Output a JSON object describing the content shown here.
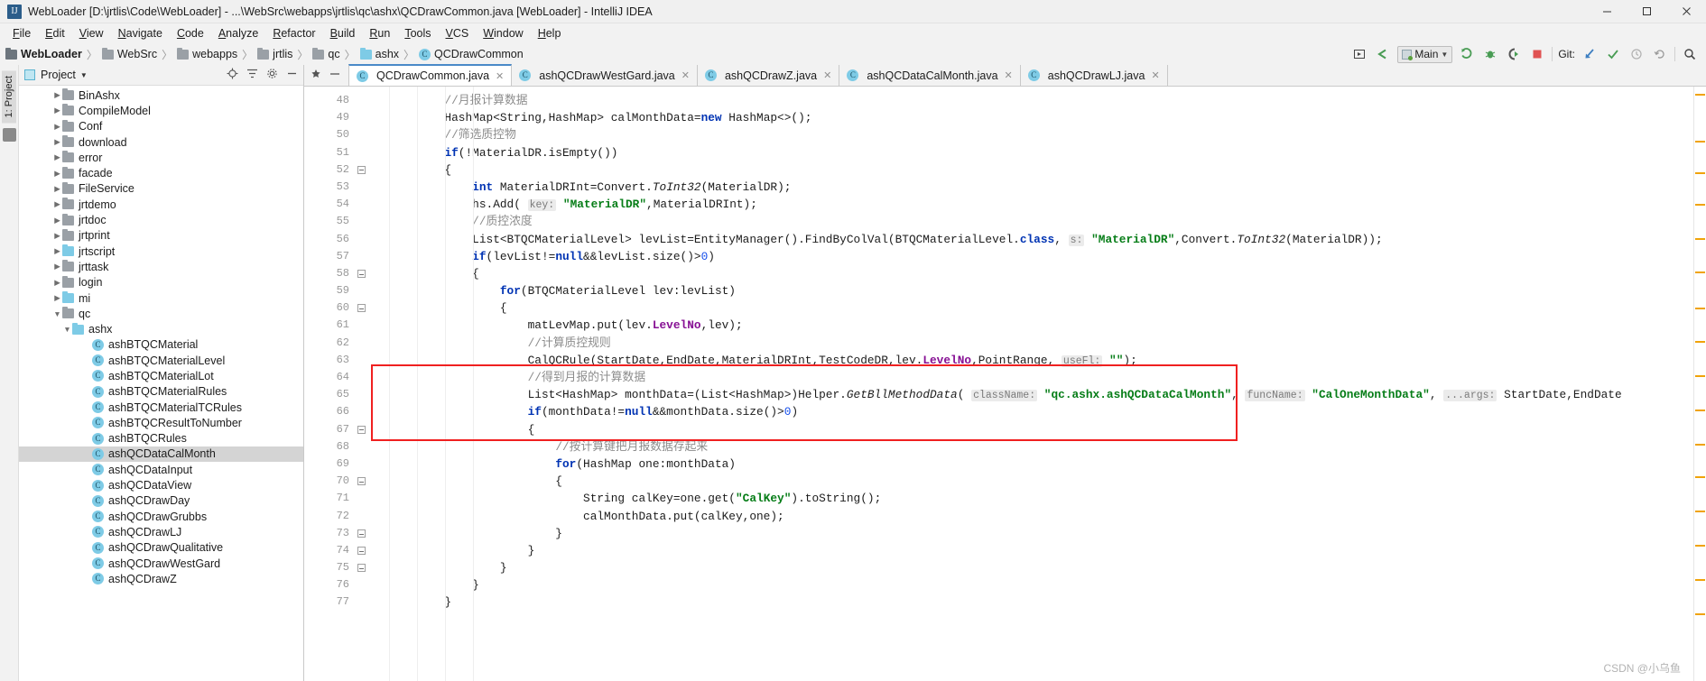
{
  "window": {
    "title": "WebLoader [D:\\jrtlis\\Code\\WebLoader] - ...\\WebSrc\\webapps\\jrtlis\\qc\\ashx\\QCDrawCommon.java [WebLoader] - IntelliJ IDEA",
    "app_icon": "IJ",
    "controls": {
      "minimize": "minimize-icon",
      "maximize": "maximize-icon",
      "close": "close-icon"
    }
  },
  "menubar": [
    "File",
    "Edit",
    "View",
    "Navigate",
    "Code",
    "Analyze",
    "Refactor",
    "Build",
    "Run",
    "Tools",
    "VCS",
    "Window",
    "Help"
  ],
  "breadcrumb": [
    {
      "label": "WebLoader",
      "type": "project",
      "bold": true
    },
    {
      "label": "WebSrc",
      "type": "folder"
    },
    {
      "label": "webapps",
      "type": "folder"
    },
    {
      "label": "jrtlis",
      "type": "folder"
    },
    {
      "label": "qc",
      "type": "folder"
    },
    {
      "label": "ashx",
      "type": "folder-blue"
    },
    {
      "label": "QCDrawCommon",
      "type": "class"
    }
  ],
  "toolbar": {
    "run_config": "Main",
    "git_label": "Git:",
    "icons": [
      "layout-icon",
      "back-arrow-icon",
      "run-icon",
      "debug-icon",
      "run-coverage-icon",
      "stop-icon",
      "git-update-icon",
      "git-commit-icon",
      "git-history-icon",
      "git-rollback-icon",
      "search-everywhere-icon"
    ]
  },
  "left_strip": {
    "tabs": [
      "1: Project"
    ],
    "icon": "structure-icon"
  },
  "project_panel": {
    "title": "Project",
    "header_icons": [
      "locate-icon",
      "collapse-all-icon",
      "settings-icon",
      "hide-icon"
    ],
    "tree": [
      {
        "label": "BinAshx",
        "type": "folder",
        "indent": 3,
        "arrow": "collapsed"
      },
      {
        "label": "CompileModel",
        "type": "folder",
        "indent": 3,
        "arrow": "collapsed"
      },
      {
        "label": "Conf",
        "type": "folder",
        "indent": 3,
        "arrow": "collapsed"
      },
      {
        "label": "download",
        "type": "folder",
        "indent": 3,
        "arrow": "collapsed"
      },
      {
        "label": "error",
        "type": "folder",
        "indent": 3,
        "arrow": "collapsed"
      },
      {
        "label": "facade",
        "type": "folder",
        "indent": 3,
        "arrow": "collapsed"
      },
      {
        "label": "FileService",
        "type": "folder",
        "indent": 3,
        "arrow": "collapsed"
      },
      {
        "label": "jrtdemo",
        "type": "folder",
        "indent": 3,
        "arrow": "collapsed"
      },
      {
        "label": "jrtdoc",
        "type": "folder",
        "indent": 3,
        "arrow": "collapsed"
      },
      {
        "label": "jrtprint",
        "type": "folder",
        "indent": 3,
        "arrow": "collapsed"
      },
      {
        "label": "jrtscript",
        "type": "folder-blue",
        "indent": 3,
        "arrow": "collapsed"
      },
      {
        "label": "jrttask",
        "type": "folder",
        "indent": 3,
        "arrow": "collapsed"
      },
      {
        "label": "login",
        "type": "folder",
        "indent": 3,
        "arrow": "collapsed"
      },
      {
        "label": "mi",
        "type": "folder-blue",
        "indent": 3,
        "arrow": "collapsed"
      },
      {
        "label": "qc",
        "type": "folder",
        "indent": 3,
        "arrow": "expanded"
      },
      {
        "label": "ashx",
        "type": "folder-blue",
        "indent": 4,
        "arrow": "expanded"
      },
      {
        "label": "ashBTQCMaterial",
        "type": "class",
        "indent": 6,
        "arrow": "none"
      },
      {
        "label": "ashBTQCMaterialLevel",
        "type": "class",
        "indent": 6,
        "arrow": "none"
      },
      {
        "label": "ashBTQCMaterialLot",
        "type": "class",
        "indent": 6,
        "arrow": "none"
      },
      {
        "label": "ashBTQCMaterialRules",
        "type": "class",
        "indent": 6,
        "arrow": "none"
      },
      {
        "label": "ashBTQCMaterialTCRules",
        "type": "class",
        "indent": 6,
        "arrow": "none"
      },
      {
        "label": "ashBTQCResultToNumber",
        "type": "class",
        "indent": 6,
        "arrow": "none"
      },
      {
        "label": "ashBTQCRules",
        "type": "class",
        "indent": 6,
        "arrow": "none"
      },
      {
        "label": "ashQCDataCalMonth",
        "type": "class",
        "indent": 6,
        "arrow": "none",
        "selected": true
      },
      {
        "label": "ashQCDataInput",
        "type": "class",
        "indent": 6,
        "arrow": "none"
      },
      {
        "label": "ashQCDataView",
        "type": "class",
        "indent": 6,
        "arrow": "none"
      },
      {
        "label": "ashQCDrawDay",
        "type": "class",
        "indent": 6,
        "arrow": "none"
      },
      {
        "label": "ashQCDrawGrubbs",
        "type": "class",
        "indent": 6,
        "arrow": "none"
      },
      {
        "label": "ashQCDrawLJ",
        "type": "class",
        "indent": 6,
        "arrow": "none"
      },
      {
        "label": "ashQCDrawQualitative",
        "type": "class",
        "indent": 6,
        "arrow": "none"
      },
      {
        "label": "ashQCDrawWestGard",
        "type": "class",
        "indent": 6,
        "arrow": "none"
      },
      {
        "label": "ashQCDrawZ",
        "type": "class",
        "indent": 6,
        "arrow": "none"
      }
    ]
  },
  "editor": {
    "tabs": [
      {
        "label": "QCDrawCommon.java",
        "active": true
      },
      {
        "label": "ashQCDrawWestGard.java",
        "active": false
      },
      {
        "label": "ashQCDrawZ.java",
        "active": false
      },
      {
        "label": "ashQCDataCalMonth.java",
        "active": false
      },
      {
        "label": "ashQCDrawLJ.java",
        "active": false
      }
    ],
    "tab_tools": [
      "pin-icon",
      "minimize-icon"
    ],
    "first_line_number": 48,
    "lines": [
      {
        "n": 48,
        "html": "        <span class='cmt'>//月报计算数据</span>"
      },
      {
        "n": 49,
        "html": "        HashMap&lt;String,HashMap&gt; calMonthData=<span class='kw'>new</span> HashMap&lt;&gt;();"
      },
      {
        "n": 50,
        "html": "        <span class='cmt'>//筛选质控物</span>"
      },
      {
        "n": 51,
        "html": "        <span class='kw'>if</span>(!MaterialDR.isEmpty())"
      },
      {
        "n": 52,
        "html": "        {"
      },
      {
        "n": 53,
        "html": "            <span class='kw'>int</span> MaterialDRInt=Convert.<span class='mth'>ToInt32</span>(MaterialDR);"
      },
      {
        "n": 54,
        "html": "            hs.Add( <span class='hint'>key:</span> <span class='str'>\"MaterialDR\"</span>,MaterialDRInt);"
      },
      {
        "n": 55,
        "html": "            <span class='cmt'>//质控浓度</span>"
      },
      {
        "n": 56,
        "html": "            List&lt;BTQCMaterialLevel&gt; levList=EntityManager().FindByColVal(BTQCMaterialLevel.<span class='kw'>class</span>, <span class='hint'>s:</span> <span class='str'>\"MaterialDR\"</span>,Convert.<span class='mth'>ToInt32</span>(MaterialDR));"
      },
      {
        "n": 57,
        "html": "            <span class='kw'>if</span>(levList!=<span class='kw'>null</span>&amp;&amp;levList.size()&gt;<span class='num'>0</span>)"
      },
      {
        "n": 58,
        "html": "            {"
      },
      {
        "n": 59,
        "html": "                <span class='kw'>for</span>(BTQCMaterialLevel lev:levList)"
      },
      {
        "n": 60,
        "html": "                {"
      },
      {
        "n": 61,
        "html": "                    matLevMap.put(lev.<span class='fld'>LevelNo</span>,lev);"
      },
      {
        "n": 62,
        "html": "                    <span class='cmt'>//计算质控规则</span>"
      },
      {
        "n": 63,
        "html": "                    CalQCRule(StartDate,EndDate,MaterialDRInt,TestCodeDR,lev.<span class='fld'>LevelNo</span>,PointRange, <span class='hint'>useFl:</span> <span class='str'>\"\"</span>);"
      },
      {
        "n": 64,
        "html": "                    <span class='cmt'>//得到月报的计算数据</span>"
      },
      {
        "n": 65,
        "html": "                    List&lt;HashMap&gt; monthData=(List&lt;HashMap&gt;)Helper.<span class='mth'>GetBllMethodData</span>( <span class='hint'>className:</span> <span class='str'>\"qc.ashx.ashQCDataCalMonth\"</span>, <span class='hint'>funcName:</span> <span class='str'>\"CalOneMonthData\"</span>, <span class='hint'>...args:</span> StartDate,EndDate"
      },
      {
        "n": 66,
        "html": "                    <span class='kw'>if</span>(monthData!=<span class='kw'>null</span>&amp;&amp;monthData.size()&gt;<span class='num'>0</span>)"
      },
      {
        "n": 67,
        "html": "                    {"
      },
      {
        "n": 68,
        "html": "                        <span class='cmt'>//按计算键把月报数据存起来</span>"
      },
      {
        "n": 69,
        "html": "                        <span class='kw'>for</span>(HashMap one:monthData)"
      },
      {
        "n": 70,
        "html": "                        {"
      },
      {
        "n": 71,
        "html": "                            String calKey=one.get(<span class='str'>\"CalKey\"</span>).toString();"
      },
      {
        "n": 72,
        "html": "                            calMonthData.put(calKey,one);"
      },
      {
        "n": 73,
        "html": "                        }"
      },
      {
        "n": 74,
        "html": "                    }"
      },
      {
        "n": 75,
        "html": "                }"
      },
      {
        "n": 76,
        "html": "            }"
      },
      {
        "n": 77,
        "html": "        }"
      }
    ],
    "highlight_box": {
      "color": "#f02020",
      "from_line": 64,
      "to_line": 67
    }
  },
  "watermark": "CSDN @小乌鱼"
}
